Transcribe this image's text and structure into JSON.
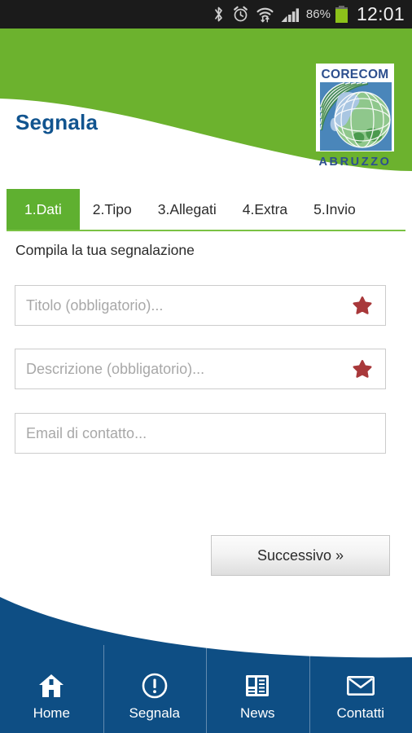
{
  "statusbar": {
    "icons": [
      "bluetooth-icon",
      "alarm-icon",
      "wifi-icon",
      "signal-icon"
    ],
    "battery_percent": "86%",
    "clock": "12:01",
    "battery_color": "#8cc21a",
    "background": "#1b1b1b"
  },
  "header": {
    "title": "Segnala",
    "title_color": "#11548f",
    "background": "#6cb22e",
    "logo": {
      "word": "CORECOM",
      "sub": "ABRUZZO",
      "text_color": "#2d4f8e"
    }
  },
  "tabs": {
    "active_index": 0,
    "active_color": "#5fb030",
    "underline_color": "#7ac243",
    "items": [
      {
        "label": "1.Dati"
      },
      {
        "label": "2.Tipo"
      },
      {
        "label": "3.Allegati"
      },
      {
        "label": "4.Extra"
      },
      {
        "label": "5.Invio"
      }
    ]
  },
  "form": {
    "heading": "Compila la tua segnalazione",
    "required_star_color": "#a8383a",
    "fields": [
      {
        "name": "titolo",
        "placeholder": "Titolo (obbligatorio)...",
        "value": "",
        "required": true
      },
      {
        "name": "descrizione",
        "placeholder": "Descrizione (obbligatorio)...",
        "value": "",
        "required": true
      },
      {
        "name": "email",
        "placeholder": "Email di contatto...",
        "value": "",
        "required": false
      }
    ],
    "next_button": "Successivo »"
  },
  "bottomnav": {
    "background": "#0e4e84",
    "items": [
      {
        "label": "Home",
        "icon": "home-icon"
      },
      {
        "label": "Segnala",
        "icon": "exclamation-circle-icon"
      },
      {
        "label": "News",
        "icon": "newspaper-icon"
      },
      {
        "label": "Contatti",
        "icon": "envelope-icon"
      }
    ]
  }
}
